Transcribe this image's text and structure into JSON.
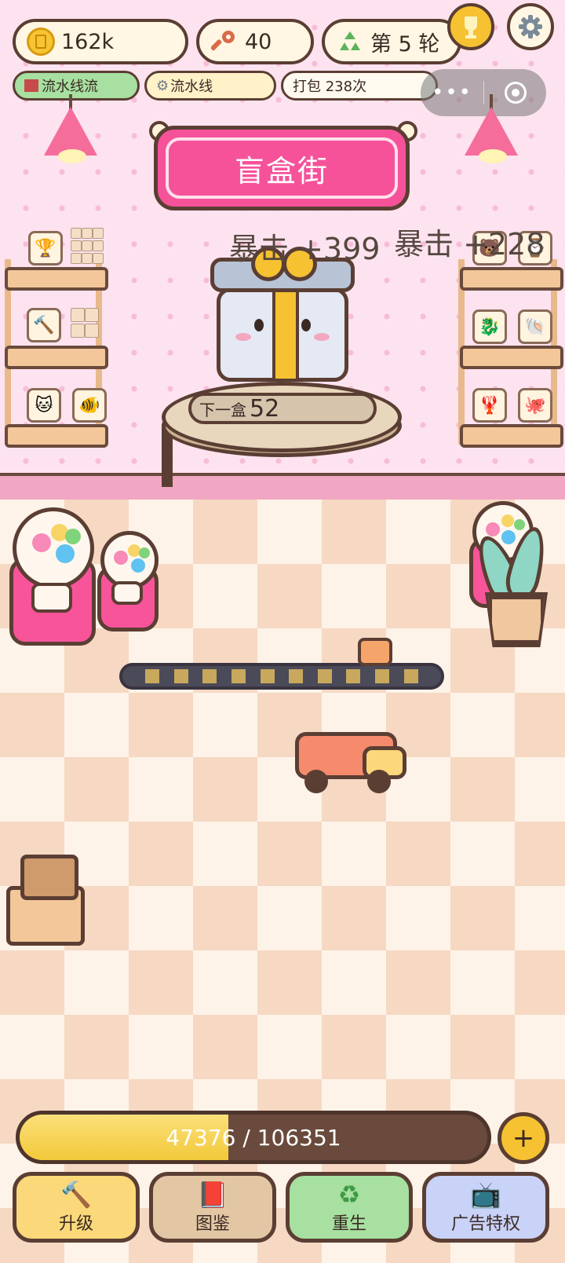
{
  "stats": {
    "coins": "162k",
    "keys": "40",
    "round": "第 5 轮"
  },
  "tags": {
    "line_mode": "流水线流",
    "line_settings": "流水线",
    "pack_count": "打包 238次"
  },
  "sign": {
    "title": "盲盒街"
  },
  "floaters": {
    "crit_left": "暴击 +399",
    "crit_right": "暴击 +228"
  },
  "pedestal": {
    "next_label": "下一盒",
    "next_value": "52"
  },
  "progress": {
    "label": "47376 / 106351",
    "fraction": 0.4455
  },
  "nav": {
    "upgrade": "升级",
    "collection": "图鉴",
    "rebirth": "重生",
    "ad_privilege": "广告特权"
  },
  "icons": {
    "coin": "coin-icon",
    "key": "key-icon",
    "recycle": "recycle-icon",
    "trophy": "trophy-icon",
    "settings": "gear-icon",
    "factory": "factory-icon",
    "gear": "gear-icon",
    "hammer": "hammer-icon",
    "book": "book-icon",
    "tv": "tv-icon"
  },
  "colors": {
    "accent_pink": "#f6529a",
    "gold": "#f6c231",
    "outline": "#5b3e33"
  }
}
